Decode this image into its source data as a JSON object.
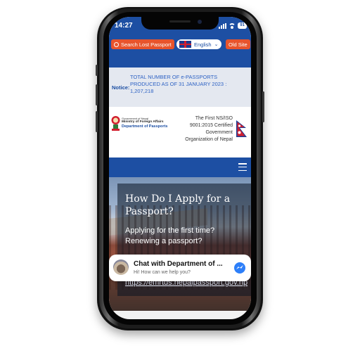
{
  "status_bar": {
    "time": "14:27",
    "battery": "91"
  },
  "topbar": {
    "search_button": "Search Lost Passport",
    "language": "English",
    "old_site_button": "Old Site",
    "search_icon": "search-icon",
    "flag_icon": "uk-flag-icon"
  },
  "notice": {
    "label": "Notice:",
    "text": "TOTAL NUMBER OF e-PASSPORTS PRODUCED AS OF 31 JANUARY 2023 : 1,207,218"
  },
  "header": {
    "gov_line": "Government of Nepal",
    "ministry_line": "Ministry of Foreign Affairs",
    "department_line": "Department of Passports",
    "iso_text": "The First NS/ISO 9001:2015 Certified Government Organization of Nepal"
  },
  "hero": {
    "title": "How Do I Apply for a Passport?",
    "question_1": "Applying for the first time?",
    "question_2": "Renewing a passport?",
    "link": "https://emrtds.nepalpassport.gov.np"
  },
  "chat": {
    "title": "Chat with Department of ...",
    "subtitle": "Hi! How can we help you?",
    "icon": "messenger-icon"
  },
  "colors": {
    "brand_blue": "#1d4fa3",
    "accent_orange": "#e8542c",
    "notice_bg": "#e4e8f0"
  }
}
